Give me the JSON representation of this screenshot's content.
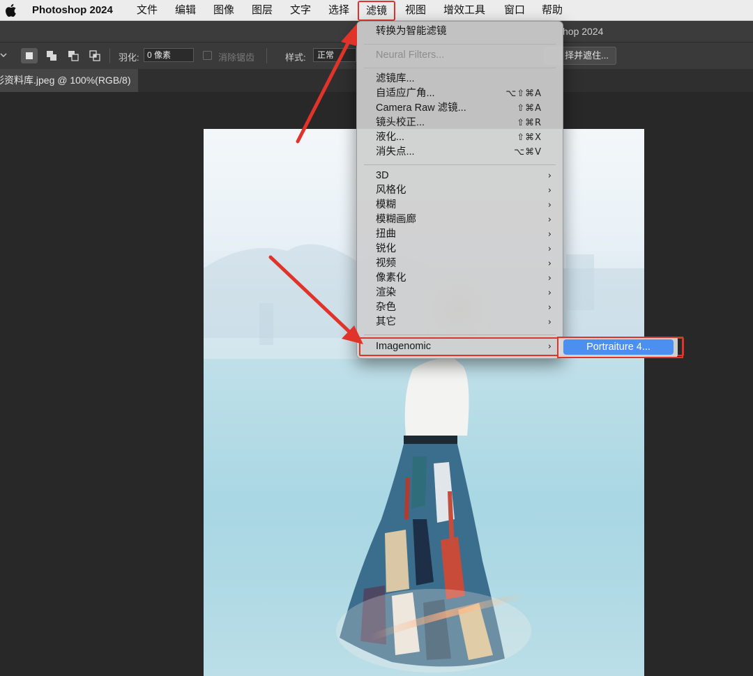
{
  "menubar": {
    "app_name": "Photoshop 2024",
    "items": [
      "文件",
      "编辑",
      "图像",
      "图层",
      "文字",
      "选择",
      "滤镜",
      "视图",
      "增效工具",
      "窗口",
      "帮助"
    ]
  },
  "window": {
    "title": "hop 2024"
  },
  "options_bar": {
    "feather_label": "羽化:",
    "feather_value": "0 像素",
    "antialias_label": "消除锯齿",
    "style_label": "样式:",
    "style_value": "正常",
    "select_mask_label": "择并遮住..."
  },
  "document_tab": {
    "label": "彩资料库.jpeg @ 100%(RGB/8)"
  },
  "filter_menu": {
    "items": [
      {
        "label": "转换为智能滤镜"
      },
      {
        "label": "Neural Filters...",
        "disabled": true
      },
      {
        "label": "滤镜库..."
      },
      {
        "label": "自适应广角...",
        "shortcut": "⌥⇧⌘A"
      },
      {
        "label": "Camera Raw 滤镜...",
        "shortcut": "⇧⌘A"
      },
      {
        "label": "镜头校正...",
        "shortcut": "⇧⌘R"
      },
      {
        "label": "液化...",
        "shortcut": "⇧⌘X"
      },
      {
        "label": "消失点...",
        "shortcut": "⌥⌘V"
      },
      {
        "label": "3D",
        "submenu": true
      },
      {
        "label": "风格化",
        "submenu": true
      },
      {
        "label": "模糊",
        "submenu": true
      },
      {
        "label": "模糊画廊",
        "submenu": true
      },
      {
        "label": "扭曲",
        "submenu": true
      },
      {
        "label": "锐化",
        "submenu": true
      },
      {
        "label": "视频",
        "submenu": true
      },
      {
        "label": "像素化",
        "submenu": true
      },
      {
        "label": "渲染",
        "submenu": true
      },
      {
        "label": "杂色",
        "submenu": true
      },
      {
        "label": "其它",
        "submenu": true
      },
      {
        "label": "Imagenomic",
        "submenu": true
      }
    ],
    "chevron": "›"
  },
  "submenu": {
    "item": "Portraiture 4..."
  },
  "colors": {
    "highlight": "#e0342b",
    "selection_blue": "#4b8ff0",
    "menu_bg": "#cecece",
    "canvas_bg": "#282828"
  }
}
